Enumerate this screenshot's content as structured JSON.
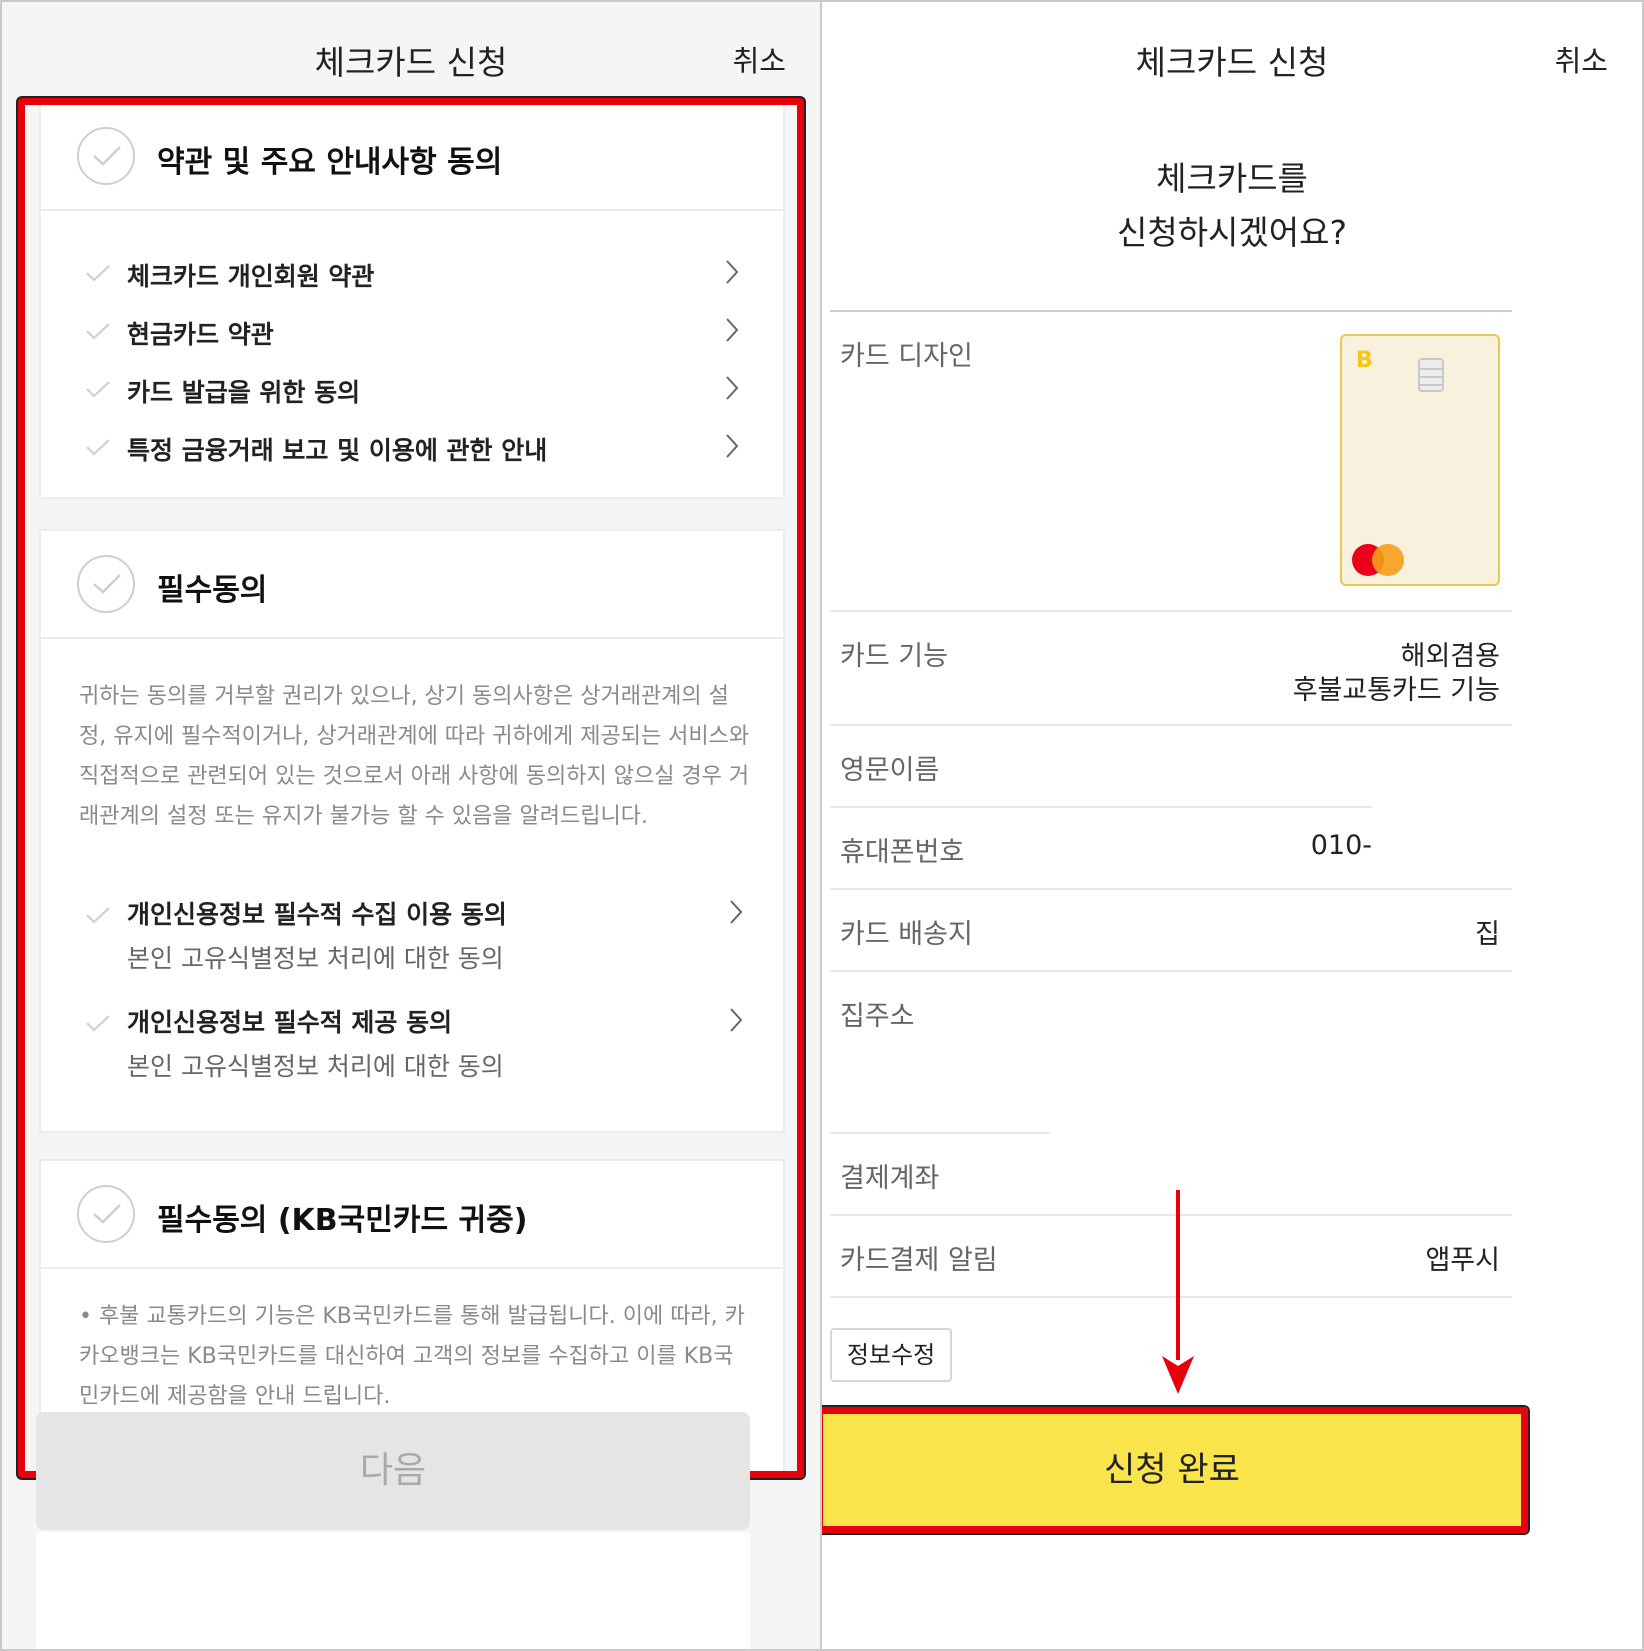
{
  "left": {
    "header": {
      "title": "체크카드 신청",
      "cancel": "취소"
    },
    "terms_card": {
      "title": "약관 및 주요 안내사항 동의",
      "items": [
        {
          "label": "체크카드 개인회원 약관"
        },
        {
          "label": "현금카드 약관"
        },
        {
          "label": "카드 발급을 위한 동의"
        },
        {
          "label": "특정 금융거래 보고 및 이용에 관한 안내"
        }
      ]
    },
    "required_card": {
      "title": "필수동의",
      "notice": "귀하는 동의를 거부할 권리가 있으나, 상기 동의사항은 상거래관계의 설정, 유지에 필수적이거나, 상거래관계에 따라 귀하에게 제공되는 서비스와 직접적으로 관련되어 있는 것으로서 아래 사항에 동의하지 않으실 경우 거래관계의 설정 또는 유지가 불가능 할 수 있음을 알려드립니다.",
      "items": [
        {
          "label": "개인신용정보 필수적 수집 이용 동의",
          "sub": "본인 고유식별정보 처리에 대한 동의"
        },
        {
          "label": "개인신용정보 필수적 제공 동의",
          "sub": "본인 고유식별정보 처리에 대한 동의"
        }
      ]
    },
    "kb_card": {
      "title": "필수동의 (KB국민카드 귀중)",
      "notice": "• 후불 교통카드의 기능은 KB국민카드를 통해 발급됩니다. 이에 따라, 카카오뱅크는 KB국민카드를 대신하여 고객의 정보를 수집하고 이를 KB국민카드에 제공함을 안내 드립니다."
    },
    "next_button": "다음"
  },
  "right": {
    "header": {
      "title": "체크카드 신청",
      "cancel": "취소"
    },
    "question_line1": "체크카드를",
    "question_line2": "신청하시겠어요?",
    "rows": {
      "design": {
        "label": "카드 디자인"
      },
      "function": {
        "label": "카드 기능",
        "value1": "해외겸용",
        "value2": "후불교통카드 기능"
      },
      "english_name": {
        "label": "영문이름"
      },
      "phone": {
        "label": "휴대폰번호",
        "value": "010-"
      },
      "delivery": {
        "label": "카드 배송지",
        "value": "집"
      },
      "address": {
        "label": "집주소"
      },
      "account": {
        "label": "결제계좌"
      },
      "alert": {
        "label": "카드결제 알림",
        "value": "앱푸시"
      }
    },
    "card_image": {
      "brand_mark": "B"
    },
    "edit_button": "정보수정",
    "submit_button": "신청 완료"
  },
  "colors": {
    "highlight_border": "#e8000a",
    "submit_yellow": "#f9e44b",
    "disabled_button": "#e5e5e5",
    "card_gold": "#e9c84f",
    "mastercard_red": "#eb001b",
    "mastercard_orange": "#f79e1b"
  }
}
